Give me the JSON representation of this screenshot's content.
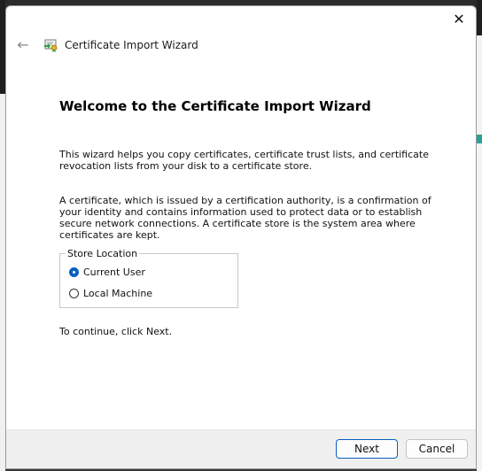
{
  "window": {
    "close_glyph": "✕",
    "back_glyph": "←",
    "title": "Certificate Import Wizard"
  },
  "content": {
    "heading": "Welcome to the Certificate Import Wizard",
    "paragraph1": "This wizard helps you copy certificates, certificate trust lists, and certificate revocation lists from your disk to a certificate store.",
    "paragraph2": "A certificate, which is issued by a certification authority, is a confirmation of your identity and contains information used to protect data or to establish secure network connections. A certificate store is the system area where certificates are kept.",
    "store_location": {
      "legend": "Store Location",
      "options": [
        {
          "label": "Current User",
          "selected": true
        },
        {
          "label": "Local Machine",
          "selected": false
        }
      ]
    },
    "continue_text": "To continue, click Next."
  },
  "footer": {
    "next_label": "Next",
    "cancel_label": "Cancel"
  },
  "colors": {
    "accent": "#0a5fc0",
    "footer_bg": "#f0f0f0"
  },
  "icons": [
    "close-icon",
    "back-arrow-icon",
    "certificate-icon"
  ]
}
